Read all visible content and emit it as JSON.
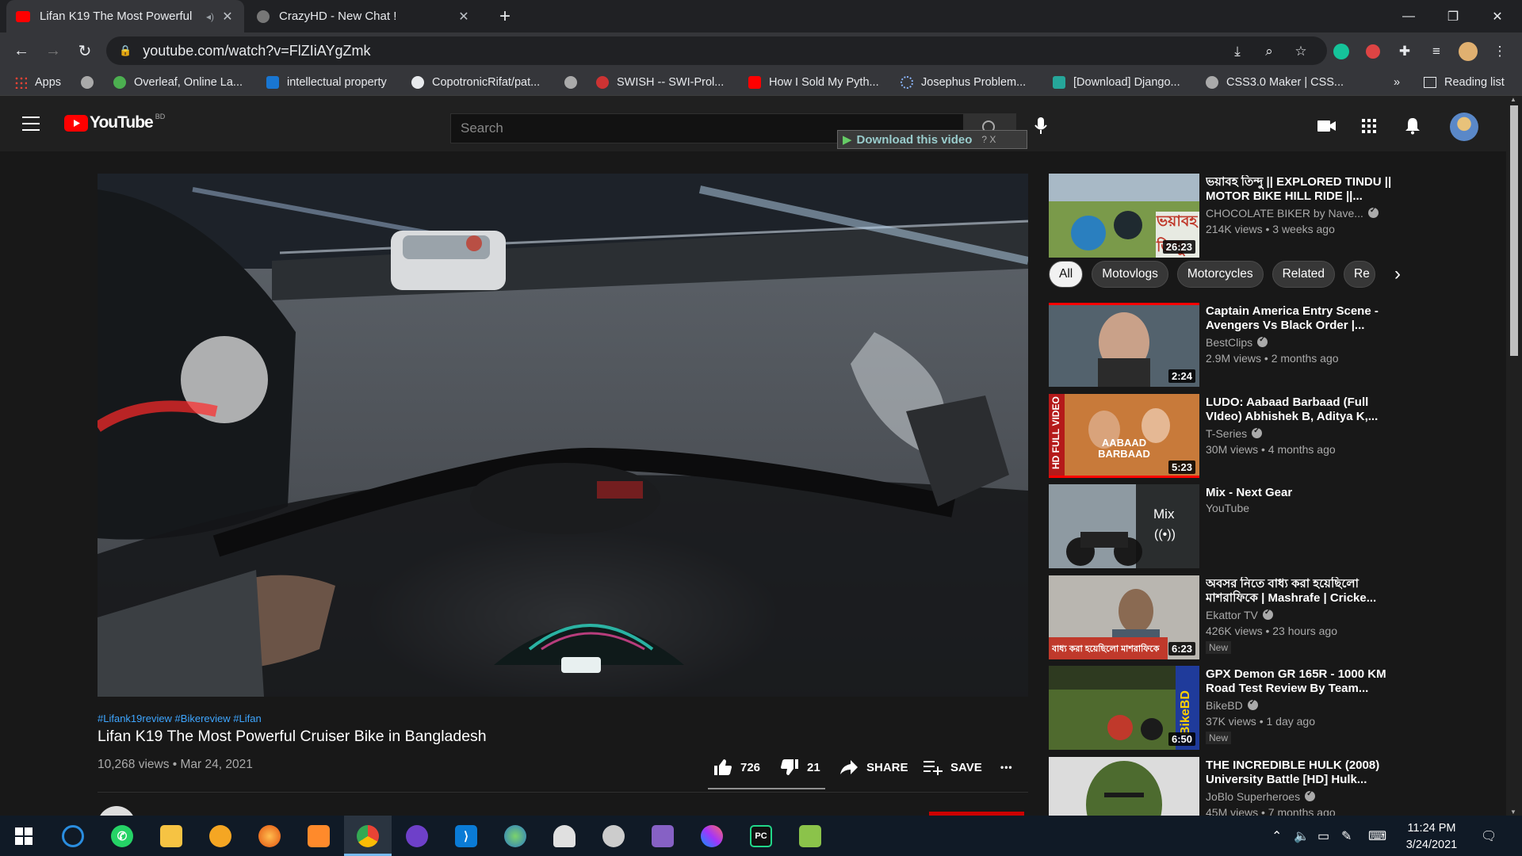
{
  "browser": {
    "tabs": [
      {
        "title": "Lifan K19 The Most Powerful",
        "favicon": "youtube-icon",
        "active": true
      },
      {
        "title": "CrazyHD - New Chat !",
        "favicon": "globe-icon",
        "active": false
      }
    ],
    "url": "youtube.com/watch?v=FlZIiAYgZmk",
    "bookmarks": [
      "Apps",
      "",
      "Overleaf, Online La...",
      "intellectual property",
      "CopotronicRifat/pat...",
      "",
      "SWISH -- SWI-Prol...",
      "How I Sold My Pyth...",
      "Josephus Problem...",
      "[Download] Django...",
      "CSS3.0 Maker | CSS..."
    ],
    "bookmarks_overflow": "»",
    "reading_list": "Reading list"
  },
  "youtube": {
    "logo_text": "YouTube",
    "logo_region": "BD",
    "search_placeholder": "Search",
    "download_bar": "Download this video",
    "download_bar_extras": "?  X"
  },
  "video": {
    "hashtags": "#Lifank19review #Bikereview #Lifan",
    "title": "Lifan K19 The Most Powerful Cruiser Bike in Bangladesh",
    "views_date": "10,268 views • Mar 24, 2021",
    "likes": "726",
    "dislikes": "21",
    "share": "SHARE",
    "save": "SAVE",
    "more": "•••",
    "subscribe_hint": ""
  },
  "sidebar": {
    "chips": [
      "All",
      "Motovlogs",
      "Motorcycles",
      "Related",
      "Re"
    ],
    "chip_next": "›",
    "first": {
      "title": "ভয়াবহ তিন্দু || EXPLORED TINDU || MOTOR BIKE HILL RIDE ||...",
      "channel": "CHOCOLATE BIKER by Nave...",
      "views": "214K views • 3 weeks ago",
      "duration": "26:23",
      "thumb_text": "ভয়াবহ তিন্দু"
    },
    "items": [
      {
        "title": "Captain America Entry Scene - Avengers Vs Black Order |...",
        "channel": "BestClips",
        "views": "2.9M views • 2 months ago",
        "duration": "2:24",
        "new": ""
      },
      {
        "title": "LUDO: Aabaad Barbaad (Full VIdeo) Abhishek B, Aditya K,...",
        "channel": "T-Series",
        "views": "30M views • 4 months ago",
        "duration": "5:23",
        "new": "",
        "thumb_text": "AABAAD BARBAAD",
        "side_text": "HD FULL VIDEO"
      },
      {
        "title": "Mix - Next Gear",
        "channel": "YouTube",
        "views": "",
        "duration": "",
        "new": "",
        "mix_label": "Mix"
      },
      {
        "title": "অবসর নিতে বাধ্য করা হয়েছিলো মাশরাফিকে | Mashrafe | Cricke...",
        "channel": "Ekattor TV",
        "views": "426K views • 23 hours ago",
        "duration": "6:23",
        "new": "New",
        "thumb_text": "বাধ্য করা হয়েছিলো মাশরাফিকে"
      },
      {
        "title": "GPX Demon GR 165R - 1000 KM Road Test Review By Team...",
        "channel": "BikeBD",
        "views": "37K views • 1 day ago",
        "duration": "6:50",
        "new": "New",
        "thumb_text": "BikeBD"
      },
      {
        "title": "THE INCREDIBLE HULK (2008) University Battle [HD] Hulk...",
        "channel": "JoBlo Superheroes",
        "views": "45M views • 7 months ago",
        "duration": "",
        "new": ""
      }
    ]
  },
  "taskbar": {
    "time": "11:24 PM",
    "date": "3/24/2021"
  },
  "colors": {
    "youtube_red": "#ff0000",
    "link_blue": "#3ea6ff",
    "bg": "#181818"
  }
}
